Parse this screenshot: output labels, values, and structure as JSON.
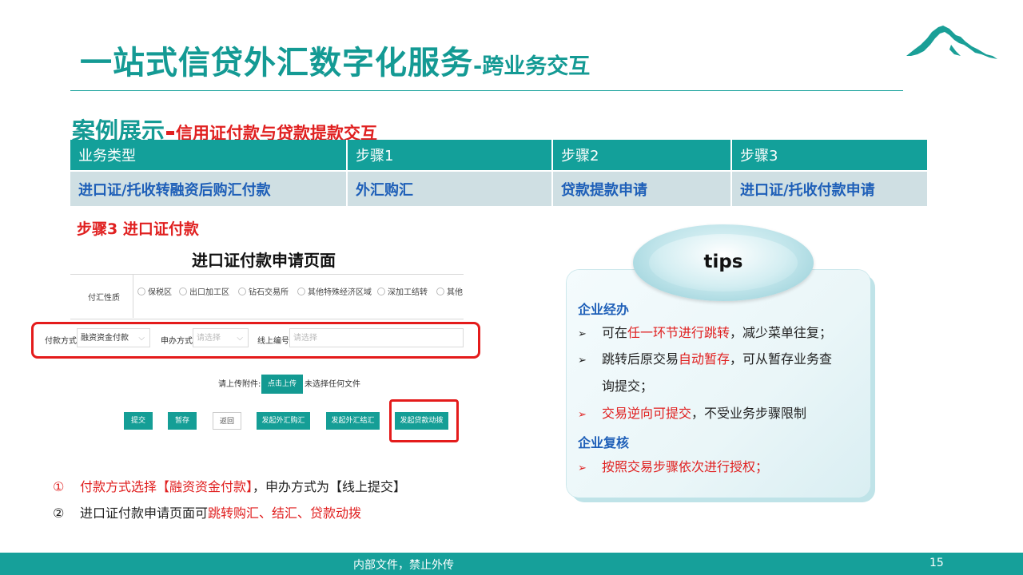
{
  "header": {
    "title_main": "一站式信贷外汇数字化服务",
    "title_sub": "-跨业务交互"
  },
  "case": {
    "title_a": "案例展示",
    "title_b": "信用证付款与贷款提款交互"
  },
  "steps_table": {
    "headers": [
      "业务类型",
      "步骤1",
      "步骤2",
      "步骤3"
    ],
    "row": [
      "进口证/托收转融资后购汇付款",
      "外汇购汇",
      "贷款提款申请",
      "进口证/托收付款申请"
    ]
  },
  "step3_label": "步骤3 进口证付款",
  "page_heading": "进口证付款申请页面",
  "form": {
    "remit_label": "付汇性质",
    "remit_options": [
      "保税区",
      "出口加工区",
      "钻石交易所",
      "其他特殊经济区域",
      "深加工结转",
      "其他"
    ],
    "pay_method_label": "付款方式",
    "pay_method_value": "融资资金付款",
    "handle_method_label": "申办方式",
    "handle_method_placeholder": "请选择",
    "online_no_label": "线上编号",
    "online_no_placeholder": "请选择",
    "upload_label": "请上传附件:",
    "upload_button": "点击上传",
    "upload_note": "未选择任何文件",
    "buttons": [
      "提交",
      "暂存",
      "返回",
      "发起外汇购汇",
      "发起外汇结汇",
      "发起贷款动拨"
    ]
  },
  "notes": [
    {
      "num": "①",
      "red": "付款方式选择【融资资金付款】",
      "black": "，申办方式为【线上提交】"
    },
    {
      "num": "②",
      "black": "进口证付款申请页面可",
      "red": "跳转购汇、结汇、贷款动拨"
    }
  ],
  "tips": {
    "label": "tips",
    "section1": "企业经办",
    "item1_pre": "可在",
    "item1_red": "任一环节进行跳转",
    "item1_post": "，减少菜单往复；",
    "item2_pre": "跳转后原交易",
    "item2_red": "自动暂存",
    "item2_post": "，可从暂存业务查",
    "item2_cont": "询提交；",
    "item3_red": "交易逆向可提交",
    "item3_post": "，不受业务步骤限制",
    "section2": "企业复核",
    "item4_red": "按照交易步骤依次进行授权；"
  },
  "footer": {
    "text": "内部文件，禁止外传",
    "page": "15"
  },
  "colors": {
    "teal": "#149a94",
    "red": "#e02020",
    "blue": "#1e5fb8"
  }
}
